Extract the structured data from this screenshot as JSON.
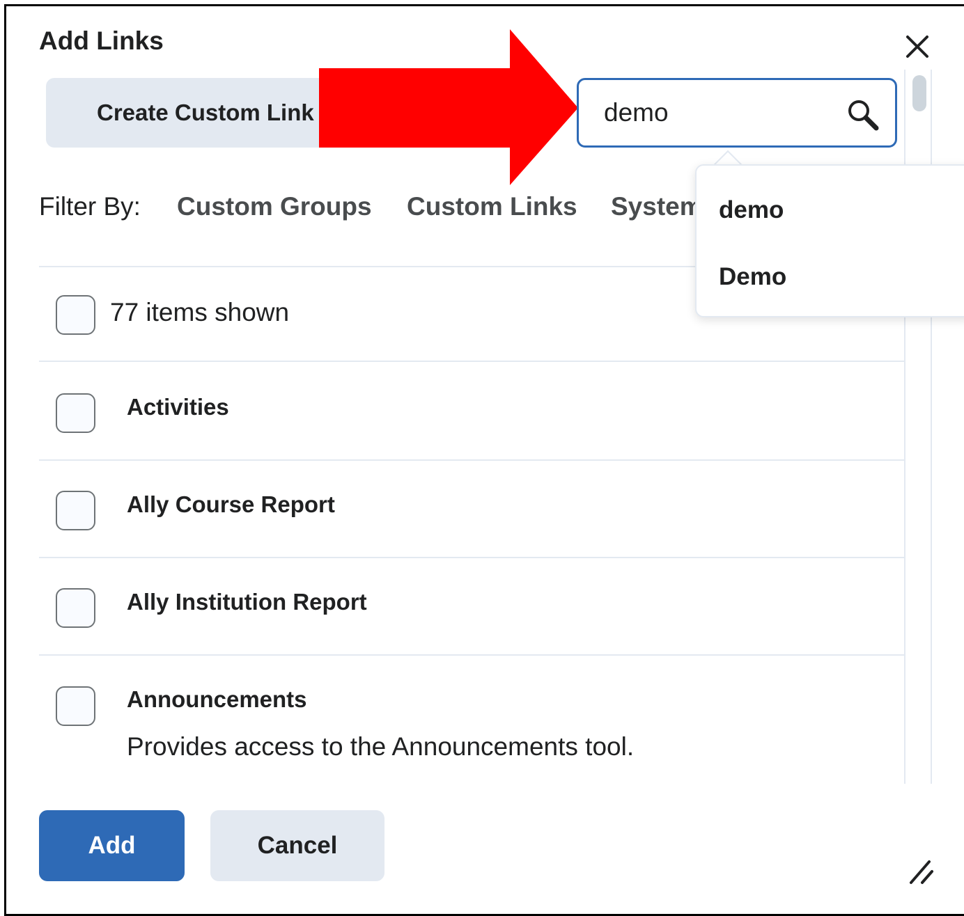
{
  "dialog": {
    "title": "Add Links",
    "close_icon": "close-icon",
    "create_custom_link": "Create Custom Link",
    "annotation_arrow_color": "#ff0000"
  },
  "search": {
    "value": "demo",
    "icon": "search-icon",
    "border_color": "#2e6ab6",
    "suggestions": [
      "demo",
      "Demo"
    ]
  },
  "filter": {
    "label": "Filter By:",
    "options": [
      "Custom Groups",
      "Custom Links",
      "System"
    ]
  },
  "list": {
    "count_label": "77 items shown",
    "items": [
      {
        "title": "Activities"
      },
      {
        "title": "Ally Course Report"
      },
      {
        "title": "Ally Institution Report"
      },
      {
        "title": "Announcements",
        "description": "Provides access to the Announcements tool."
      }
    ]
  },
  "footer": {
    "add_label": "Add",
    "cancel_label": "Cancel",
    "primary_color": "#2e6ab6",
    "resize_icon": "resize-handle-icon"
  }
}
